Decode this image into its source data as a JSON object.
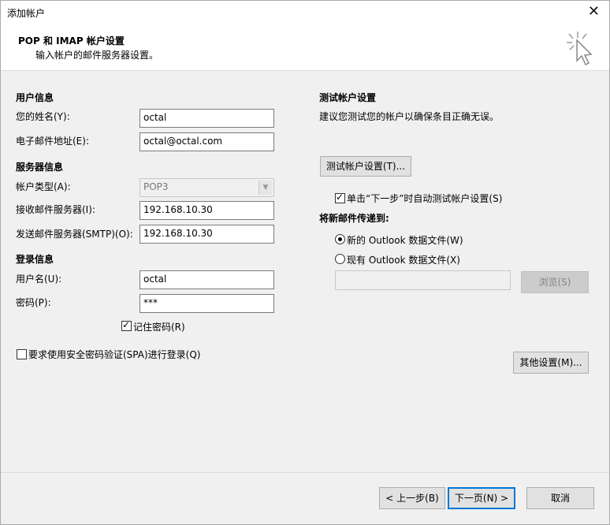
{
  "window": {
    "title": "添加帐户",
    "close_glyph": "✕"
  },
  "header": {
    "title": "POP 和 IMAP 帐户设置",
    "subtitle": "输入帐户的邮件服务器设置。"
  },
  "user_info": {
    "section": "用户信息",
    "name_label": "您的姓名(Y):",
    "name_value": "octal",
    "email_label": "电子邮件地址(E):",
    "email_value": "octal@octal.com"
  },
  "server_info": {
    "section": "服务器信息",
    "type_label": "帐户类型(A):",
    "type_value": "POP3",
    "incoming_label": "接收邮件服务器(I):",
    "incoming_value": "192.168.10.30",
    "outgoing_label": "发送邮件服务器(SMTP)(O):",
    "outgoing_value": "192.168.10.30"
  },
  "login_info": {
    "section": "登录信息",
    "username_label": "用户名(U):",
    "username_value": "octal",
    "password_label": "密码(P):",
    "password_value": "***",
    "remember_label": "记住密码(R)",
    "remember_checked": true,
    "spa_label": "要求使用安全密码验证(SPA)进行登录(Q)",
    "spa_checked": false
  },
  "test": {
    "section": "测试帐户设置",
    "description": "建议您测试您的帐户以确保条目正确无误。",
    "test_button": "测试帐户设置(T)...",
    "auto_test_label": "单击“下一步”时自动测试帐户设置(S)",
    "auto_test_checked": true
  },
  "deliver": {
    "section": "将新邮件传递到:",
    "new_file_label": "新的 Outlook 数据文件(W)",
    "existing_file_label": "现有 Outlook 数据文件(X)",
    "selected": "new",
    "path_value": "",
    "browse_button": "浏览(S)"
  },
  "more_settings_button": "其他设置(M)...",
  "footer": {
    "back_button": "< 上一步(B)",
    "next_button": "下一页(N) >",
    "cancel_button": "取消"
  }
}
